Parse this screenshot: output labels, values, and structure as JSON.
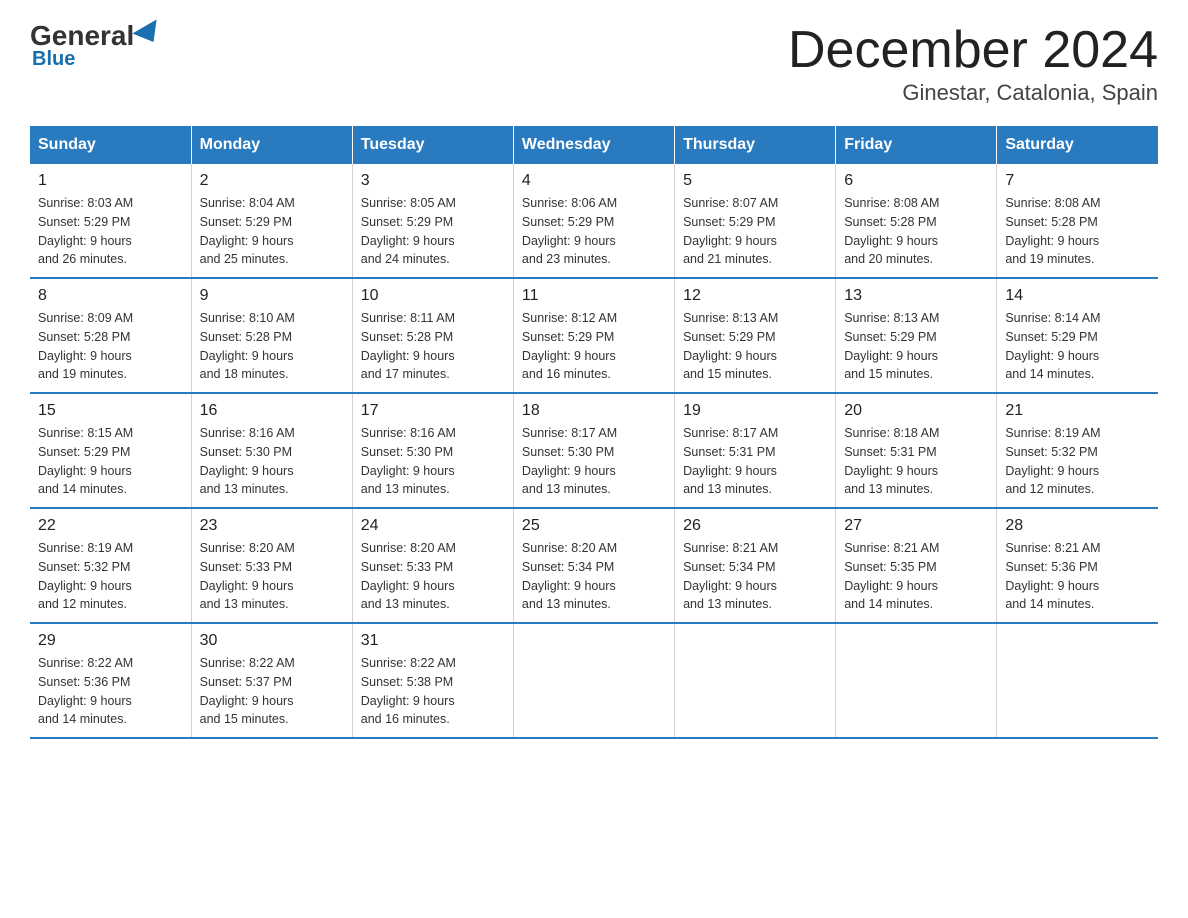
{
  "logo": {
    "general": "General",
    "blue": "Blue"
  },
  "title": "December 2024",
  "subtitle": "Ginestar, Catalonia, Spain",
  "days_of_week": [
    "Sunday",
    "Monday",
    "Tuesday",
    "Wednesday",
    "Thursday",
    "Friday",
    "Saturday"
  ],
  "weeks": [
    [
      {
        "day": "1",
        "sunrise": "8:03 AM",
        "sunset": "5:29 PM",
        "daylight": "9 hours and 26 minutes."
      },
      {
        "day": "2",
        "sunrise": "8:04 AM",
        "sunset": "5:29 PM",
        "daylight": "9 hours and 25 minutes."
      },
      {
        "day": "3",
        "sunrise": "8:05 AM",
        "sunset": "5:29 PM",
        "daylight": "9 hours and 24 minutes."
      },
      {
        "day": "4",
        "sunrise": "8:06 AM",
        "sunset": "5:29 PM",
        "daylight": "9 hours and 23 minutes."
      },
      {
        "day": "5",
        "sunrise": "8:07 AM",
        "sunset": "5:29 PM",
        "daylight": "9 hours and 21 minutes."
      },
      {
        "day": "6",
        "sunrise": "8:08 AM",
        "sunset": "5:28 PM",
        "daylight": "9 hours and 20 minutes."
      },
      {
        "day": "7",
        "sunrise": "8:08 AM",
        "sunset": "5:28 PM",
        "daylight": "9 hours and 19 minutes."
      }
    ],
    [
      {
        "day": "8",
        "sunrise": "8:09 AM",
        "sunset": "5:28 PM",
        "daylight": "9 hours and 19 minutes."
      },
      {
        "day": "9",
        "sunrise": "8:10 AM",
        "sunset": "5:28 PM",
        "daylight": "9 hours and 18 minutes."
      },
      {
        "day": "10",
        "sunrise": "8:11 AM",
        "sunset": "5:28 PM",
        "daylight": "9 hours and 17 minutes."
      },
      {
        "day": "11",
        "sunrise": "8:12 AM",
        "sunset": "5:29 PM",
        "daylight": "9 hours and 16 minutes."
      },
      {
        "day": "12",
        "sunrise": "8:13 AM",
        "sunset": "5:29 PM",
        "daylight": "9 hours and 15 minutes."
      },
      {
        "day": "13",
        "sunrise": "8:13 AM",
        "sunset": "5:29 PM",
        "daylight": "9 hours and 15 minutes."
      },
      {
        "day": "14",
        "sunrise": "8:14 AM",
        "sunset": "5:29 PM",
        "daylight": "9 hours and 14 minutes."
      }
    ],
    [
      {
        "day": "15",
        "sunrise": "8:15 AM",
        "sunset": "5:29 PM",
        "daylight": "9 hours and 14 minutes."
      },
      {
        "day": "16",
        "sunrise": "8:16 AM",
        "sunset": "5:30 PM",
        "daylight": "9 hours and 13 minutes."
      },
      {
        "day": "17",
        "sunrise": "8:16 AM",
        "sunset": "5:30 PM",
        "daylight": "9 hours and 13 minutes."
      },
      {
        "day": "18",
        "sunrise": "8:17 AM",
        "sunset": "5:30 PM",
        "daylight": "9 hours and 13 minutes."
      },
      {
        "day": "19",
        "sunrise": "8:17 AM",
        "sunset": "5:31 PM",
        "daylight": "9 hours and 13 minutes."
      },
      {
        "day": "20",
        "sunrise": "8:18 AM",
        "sunset": "5:31 PM",
        "daylight": "9 hours and 13 minutes."
      },
      {
        "day": "21",
        "sunrise": "8:19 AM",
        "sunset": "5:32 PM",
        "daylight": "9 hours and 12 minutes."
      }
    ],
    [
      {
        "day": "22",
        "sunrise": "8:19 AM",
        "sunset": "5:32 PM",
        "daylight": "9 hours and 12 minutes."
      },
      {
        "day": "23",
        "sunrise": "8:20 AM",
        "sunset": "5:33 PM",
        "daylight": "9 hours and 13 minutes."
      },
      {
        "day": "24",
        "sunrise": "8:20 AM",
        "sunset": "5:33 PM",
        "daylight": "9 hours and 13 minutes."
      },
      {
        "day": "25",
        "sunrise": "8:20 AM",
        "sunset": "5:34 PM",
        "daylight": "9 hours and 13 minutes."
      },
      {
        "day": "26",
        "sunrise": "8:21 AM",
        "sunset": "5:34 PM",
        "daylight": "9 hours and 13 minutes."
      },
      {
        "day": "27",
        "sunrise": "8:21 AM",
        "sunset": "5:35 PM",
        "daylight": "9 hours and 14 minutes."
      },
      {
        "day": "28",
        "sunrise": "8:21 AM",
        "sunset": "5:36 PM",
        "daylight": "9 hours and 14 minutes."
      }
    ],
    [
      {
        "day": "29",
        "sunrise": "8:22 AM",
        "sunset": "5:36 PM",
        "daylight": "9 hours and 14 minutes."
      },
      {
        "day": "30",
        "sunrise": "8:22 AM",
        "sunset": "5:37 PM",
        "daylight": "9 hours and 15 minutes."
      },
      {
        "day": "31",
        "sunrise": "8:22 AM",
        "sunset": "5:38 PM",
        "daylight": "9 hours and 16 minutes."
      },
      null,
      null,
      null,
      null
    ]
  ],
  "sunrise_label": "Sunrise:",
  "sunset_label": "Sunset:",
  "daylight_label": "Daylight:"
}
